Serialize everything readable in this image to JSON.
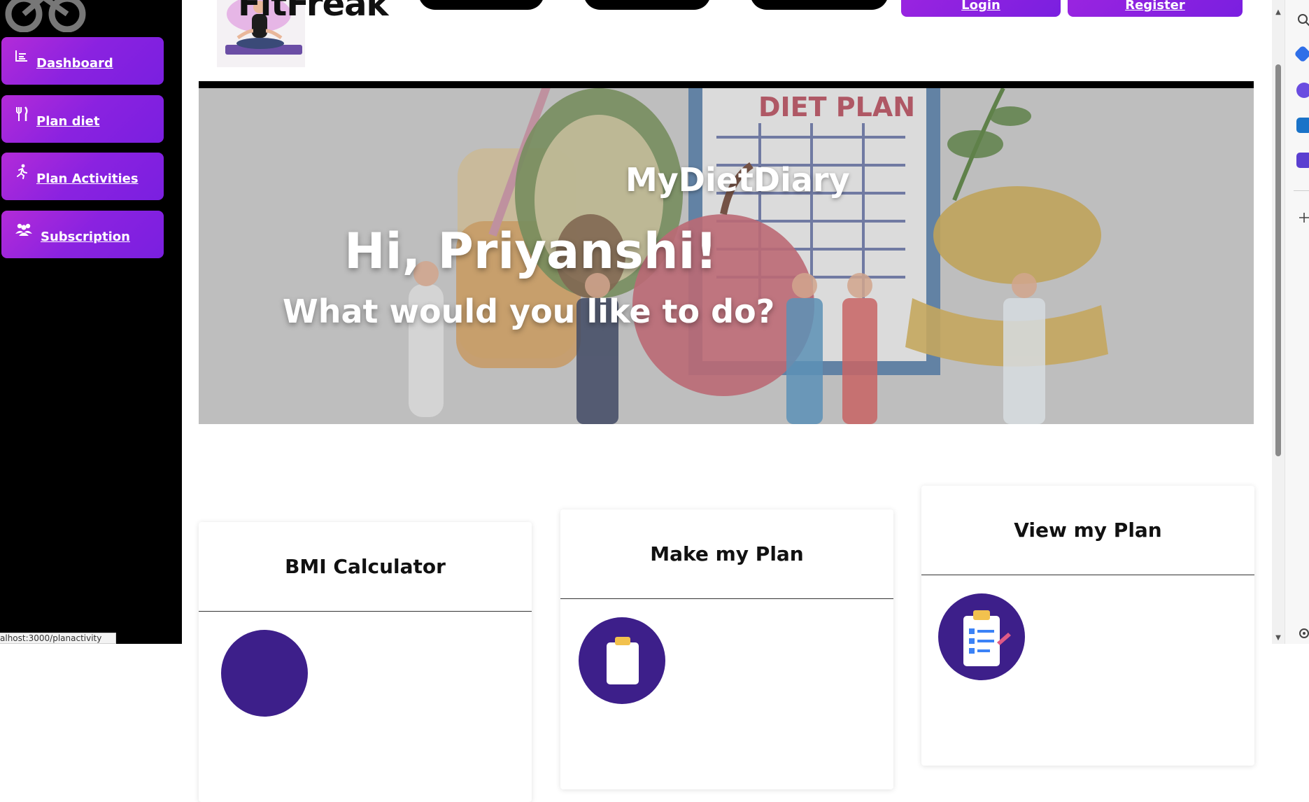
{
  "sidebar": {
    "items": [
      {
        "label": "Dashboard",
        "icon": "chart-bars-icon"
      },
      {
        "label": "Plan diet",
        "icon": "fork-knife-icon"
      },
      {
        "label": "Plan Activities",
        "icon": "running-icon"
      },
      {
        "label": "Subscription",
        "icon": "users-icon"
      }
    ]
  },
  "header": {
    "brand_partial": "FitFreak",
    "login_label": "Login",
    "register_label": "Register"
  },
  "hero": {
    "brand": "MyDietDiary",
    "greeting": "Hi, Priyanshi!",
    "question": "What would you like to do?",
    "image_caption": "DIET PLAN"
  },
  "cards": [
    {
      "title": "BMI Calculator"
    },
    {
      "title": "Make my Plan"
    },
    {
      "title": "View my Plan"
    }
  ],
  "status_bar": {
    "url_text": "alhost:3000/planactivity"
  },
  "colors": {
    "sidebar_bg": "#000000",
    "button_gradient_start": "#b32bd8",
    "button_gradient_end": "#7a1fe0",
    "card_icon_bg": "#3d1f8a"
  }
}
